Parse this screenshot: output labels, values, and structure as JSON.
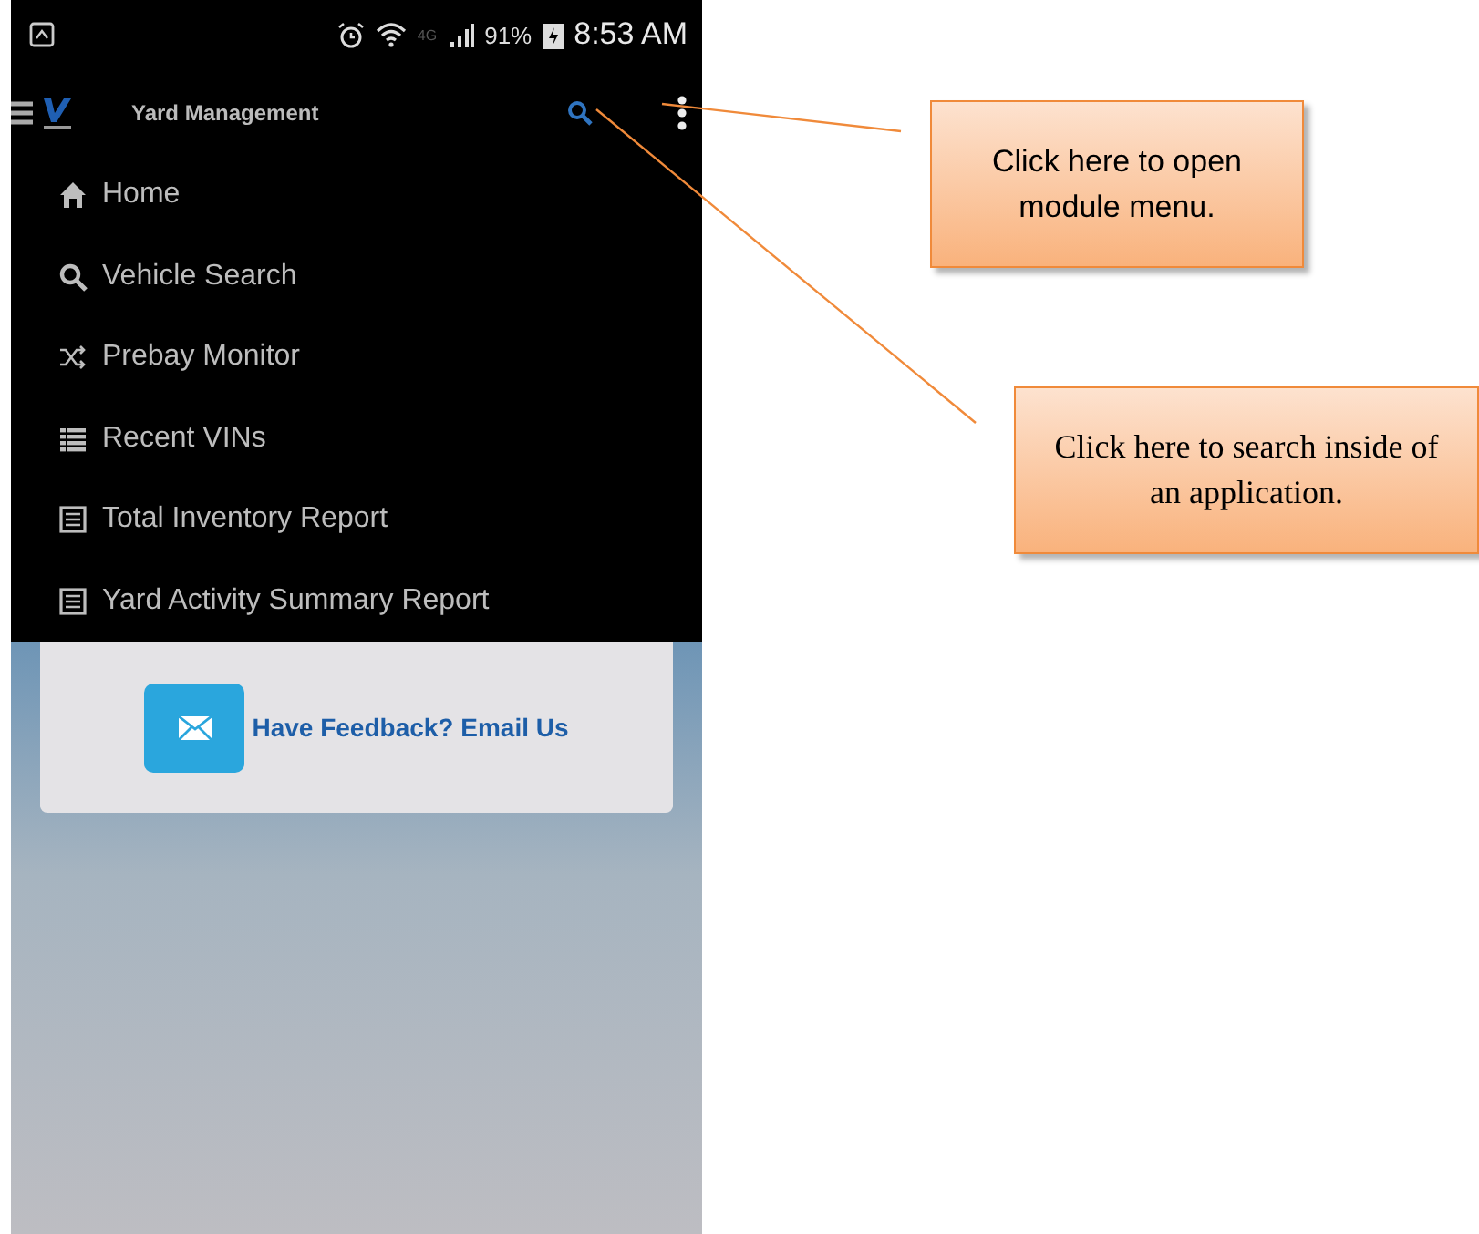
{
  "status_bar": {
    "network": "4G",
    "battery": "91%",
    "time": "8:53 AM"
  },
  "app_bar": {
    "title": "Yard Management"
  },
  "menu": {
    "items": [
      {
        "label": "Home",
        "kind": "home"
      },
      {
        "label": "Vehicle Search",
        "kind": "search"
      },
      {
        "label": "Prebay Monitor",
        "kind": "shuffle"
      },
      {
        "label": "Recent VINs",
        "kind": "list"
      },
      {
        "label": "Total Inventory Report",
        "kind": "report"
      },
      {
        "label": "Yard Activity Summary Report",
        "kind": "report"
      }
    ]
  },
  "feedback_card": {
    "link": "Have Feedback? Email Us"
  },
  "callouts": [
    {
      "text": "Click here to open module menu.",
      "kind": "sans"
    },
    {
      "text": "Click here to search inside of an application.",
      "kind": "serif"
    }
  ]
}
